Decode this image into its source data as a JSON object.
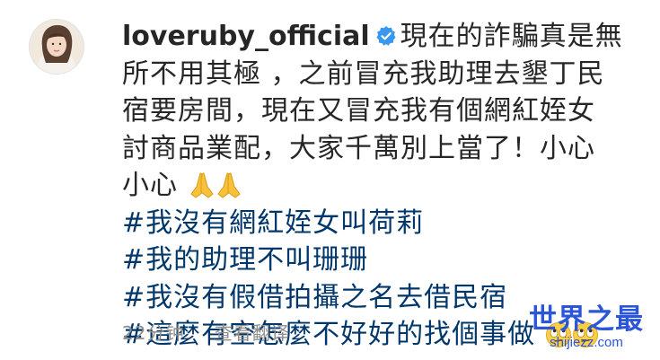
{
  "post": {
    "username": "loveruby_official",
    "caption_lines": [
      "現在的詐騙真是無",
      "所不用其極 ，之前冒充我助理去墾丁民",
      "宿要房間，現在又冒充我有個網紅姪女",
      "討商品業配，大家千萬別上當了！小心",
      "小心"
    ],
    "hashtags": [
      "#我沒有網紅姪女叫荷莉",
      "#我的助理不叫珊珊",
      "#我沒有假借拍攝之名去借民宿",
      "#這麼有空怎麼不好好的找個事做"
    ]
  },
  "meta": {
    "time": "22分钟",
    "translate_label": "查看翻译"
  },
  "watermark": {
    "title": "世界之最",
    "url": "shijiezz.com"
  },
  "colors": {
    "text": "#262626",
    "hashtag": "#00376b",
    "verified_badge": "#3897f0",
    "meta": "#8e8e8e",
    "watermark": "#2b56d8"
  },
  "icons": [
    "avatar",
    "verified-badge-icon",
    "folded-hands-emoji-icon",
    "rolling-eyes-emoji-icon"
  ]
}
